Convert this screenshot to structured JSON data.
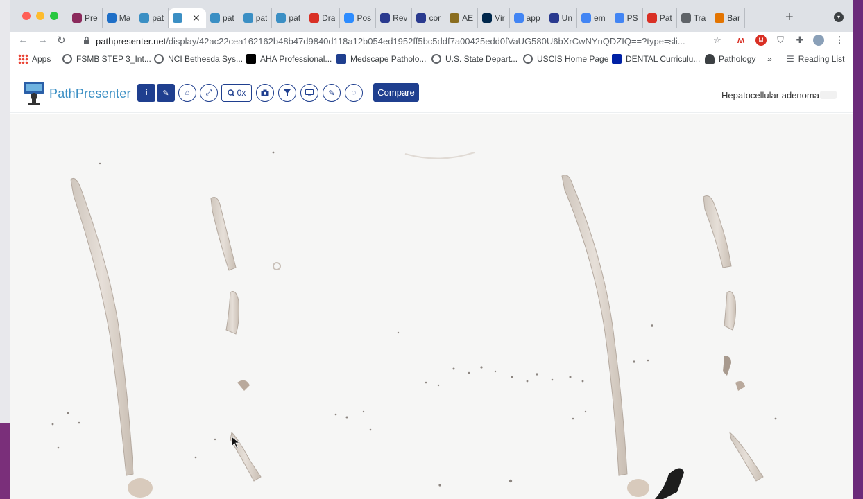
{
  "browser": {
    "tabs": [
      {
        "label": "Pre",
        "color": "#8b2a5c"
      },
      {
        "label": "Ma",
        "color": "#1f6fc7"
      },
      {
        "label": "pat",
        "color": "#3b8fc4"
      },
      {
        "label": "",
        "color": "#3b8fc4",
        "active": true
      },
      {
        "label": "pat",
        "color": "#3b8fc4"
      },
      {
        "label": "pat",
        "color": "#3b8fc4"
      },
      {
        "label": "pat",
        "color": "#3b8fc4"
      },
      {
        "label": "Dra",
        "color": "#d93025"
      },
      {
        "label": "Pos",
        "color": "#2d8cff"
      },
      {
        "label": "Rev",
        "color": "#2a3a8f"
      },
      {
        "label": "cor",
        "color": "#2a3a8f"
      },
      {
        "label": "AE",
        "color": "#8a6d1f"
      },
      {
        "label": "Vir",
        "color": "#00274c"
      },
      {
        "label": "app",
        "color": "#4285f4"
      },
      {
        "label": "Un",
        "color": "#2a3a8f"
      },
      {
        "label": "em",
        "color": "#4285f4"
      },
      {
        "label": "PS",
        "color": "#4285f4"
      },
      {
        "label": "Pat",
        "color": "#d93025"
      },
      {
        "label": "Tra",
        "color": "#5f6368"
      },
      {
        "label": "Bar",
        "color": "#e37400"
      }
    ],
    "address": {
      "host": "pathpresenter.net",
      "path": "/display/42ac22cea162162b48b47d9840d118a12b054ed1952ff5bc5ddf7a00425edd0fVaUG580U6bXrCwNYnQDZIQ==?type=sli..."
    },
    "bookmarks": [
      {
        "label": "Apps",
        "icon": "apps-grid-icon",
        "color": "#ea4335"
      },
      {
        "label": "FSMB STEP 3_Int...",
        "icon": "globe-icon",
        "color": "#5f6368"
      },
      {
        "label": "NCI Bethesda Sys...",
        "icon": "globe-icon",
        "color": "#5f6368"
      },
      {
        "label": "AHA Professional...",
        "icon": "aha-icon",
        "color": "#000000"
      },
      {
        "label": "Medscape Patholo...",
        "icon": "medscape-icon",
        "color": "#1f3f8f"
      },
      {
        "label": "U.S. State Depart...",
        "icon": "globe-icon",
        "color": "#5f6368"
      },
      {
        "label": "USCIS Home Page",
        "icon": "seal-icon",
        "color": "#5f6368"
      },
      {
        "label": "DENTAL Curriculu...",
        "icon": "uf-icon",
        "color": "#0021a5"
      },
      {
        "label": "Pathology",
        "icon": "person-icon",
        "color": "#3c4043"
      }
    ],
    "bookmarks_overflow": "»",
    "reading_list": "Reading List"
  },
  "app": {
    "brand": "PathPresenter",
    "zoom_label": "0x",
    "compare_label": "Compare",
    "case_title": "Hepatocellular adenoma",
    "accent_color": "#1f3f8f",
    "brand_color": "#3b8fc4"
  }
}
